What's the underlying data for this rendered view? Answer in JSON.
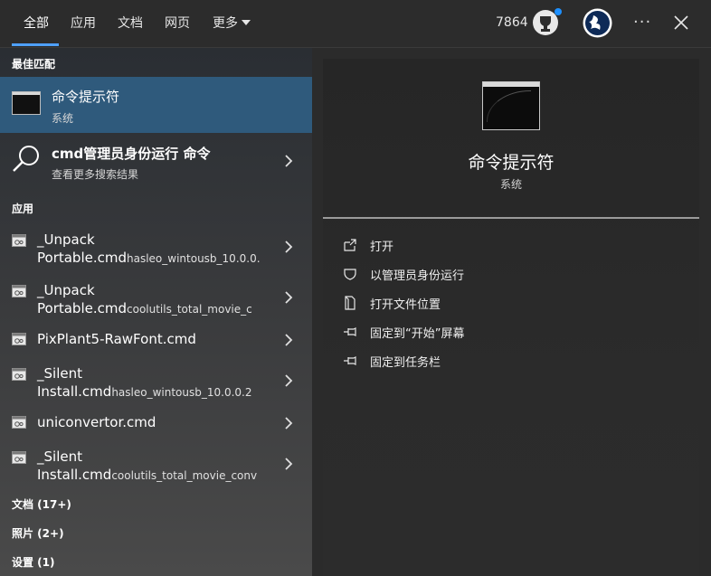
{
  "tabs": [
    {
      "label": "全部"
    },
    {
      "label": "应用"
    },
    {
      "label": "文档"
    },
    {
      "label": "网页"
    },
    {
      "label": "更多"
    }
  ],
  "header": {
    "points": "7864"
  },
  "sections": {
    "best_match": "最佳匹配",
    "apps": "应用",
    "documents": "文档 (17+)",
    "photos": "照片 (2+)",
    "settings": "设置 (1)"
  },
  "best_match": {
    "title": "命令提示符",
    "subtitle": "系统"
  },
  "web_search": {
    "title": "cmd管理员身份运行 命令",
    "subtitle": "查看更多搜索结果"
  },
  "apps": [
    {
      "line1": "_Unpack",
      "line2_main": "Portable.cmd",
      "line2_small": "hasleo_wintousb_10.0.0."
    },
    {
      "line1": "_Unpack",
      "line2_main": "Portable.cmd",
      "line2_small": "coolutils_total_movie_c"
    },
    {
      "line1": "PixPlant5-RawFont.cmd"
    },
    {
      "line1": "_Silent",
      "line2_main": "Install.cmd",
      "line2_small": "hasleo_wintousb_10.0.0.2"
    },
    {
      "line1": "uniconvertor.cmd"
    },
    {
      "line1": "_Silent",
      "line2_main": "Install.cmd",
      "line2_small": "coolutils_total_movie_conv"
    }
  ],
  "preview": {
    "title": "命令提示符",
    "subtitle": "系统"
  },
  "actions": [
    {
      "label": "打开",
      "icon": "open-icon"
    },
    {
      "label": "以管理员身份运行",
      "icon": "shield-icon"
    },
    {
      "label": "打开文件位置",
      "icon": "file-location-icon"
    },
    {
      "label": "固定到“开始”屏幕",
      "icon": "pin-icon"
    },
    {
      "label": "固定到任务栏",
      "icon": "pin-icon"
    }
  ],
  "colors": {
    "accent": "#4ea0ff",
    "selected_row": "#2f5a7c",
    "notification_dot": "#1e90ff"
  }
}
